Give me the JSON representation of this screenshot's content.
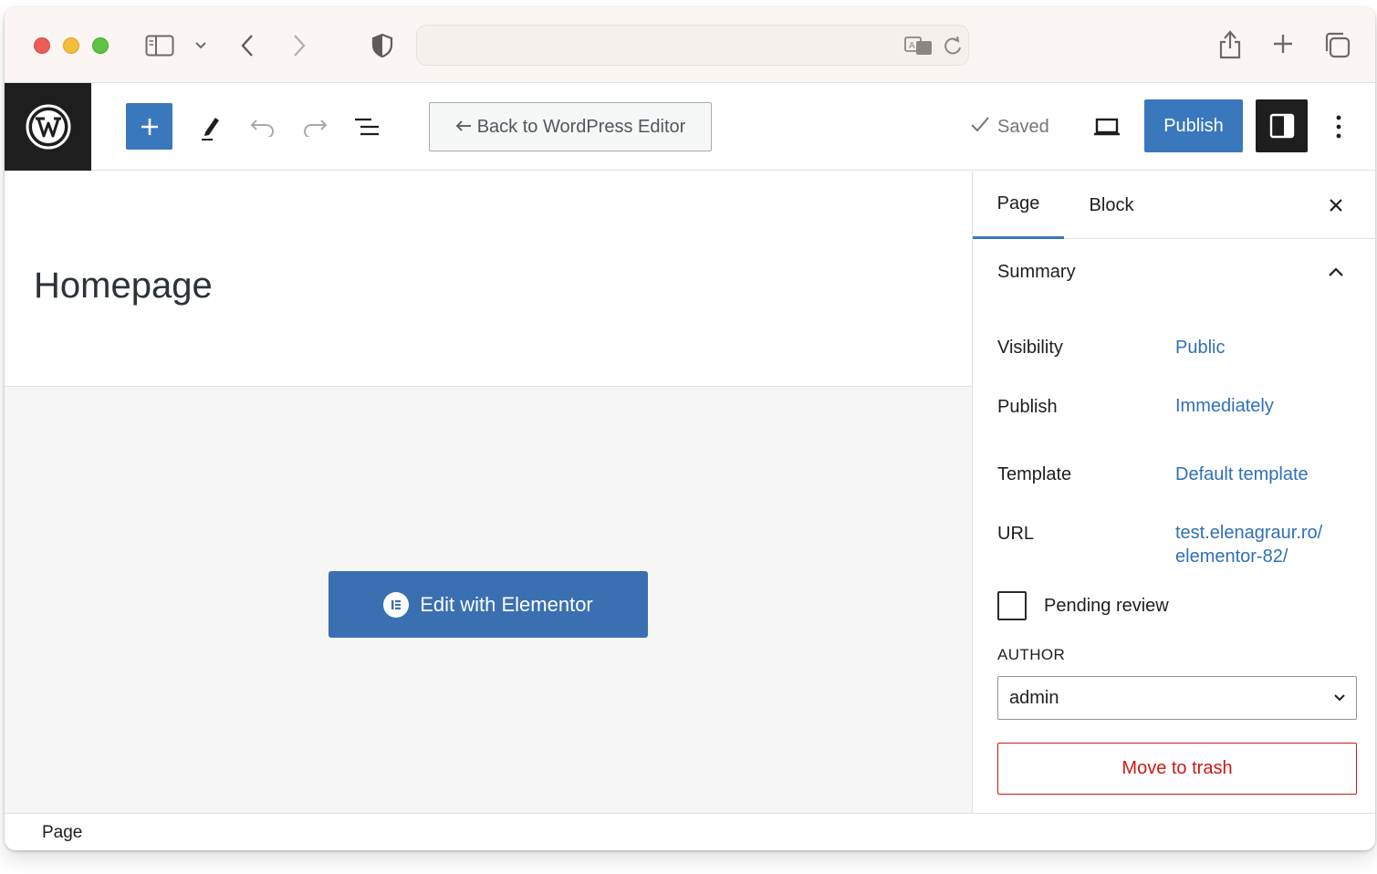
{
  "browser": {
    "address_text": "",
    "icons": [
      "sidebar-icon",
      "chevron-down-icon",
      "back-icon",
      "forward-icon",
      "shield-icon",
      "translate-icon",
      "reload-icon",
      "share-icon",
      "new-tab-icon",
      "tabs-overview-icon"
    ]
  },
  "toolbar": {
    "back_label": "Back to WordPress Editor",
    "saved_label": "Saved",
    "publish_label": "Publish",
    "icons": [
      "wordpress-logo-icon",
      "add-block-icon",
      "edit-tools-icon",
      "undo-icon",
      "redo-icon",
      "list-view-icon",
      "preview-desktop-icon",
      "settings-sidebar-icon",
      "more-options-icon"
    ]
  },
  "canvas": {
    "page_title": "Homepage",
    "elementor_button": "Edit with Elementor"
  },
  "sidebar": {
    "tabs": [
      {
        "label": "Page",
        "active": true
      },
      {
        "label": "Block",
        "active": false
      }
    ],
    "summary_title": "Summary",
    "rows": [
      {
        "label": "Visibility",
        "value": "Public"
      },
      {
        "label": "Publish",
        "value": "Immediately"
      },
      {
        "label": "Template",
        "value": "Default template"
      },
      {
        "label": "URL",
        "value_line1": "test.elenagraur.ro/",
        "value_line2": "elementor-82/"
      }
    ],
    "pending_review": "Pending review",
    "author_label": "AUTHOR",
    "author_value": "admin",
    "trash_label": "Move to trash"
  },
  "footer": {
    "breadcrumb": "Page"
  },
  "colors": {
    "accent": "#3a78bd",
    "link": "#2f6fba",
    "danger": "#cc1818",
    "dark": "#1e1e1e"
  }
}
